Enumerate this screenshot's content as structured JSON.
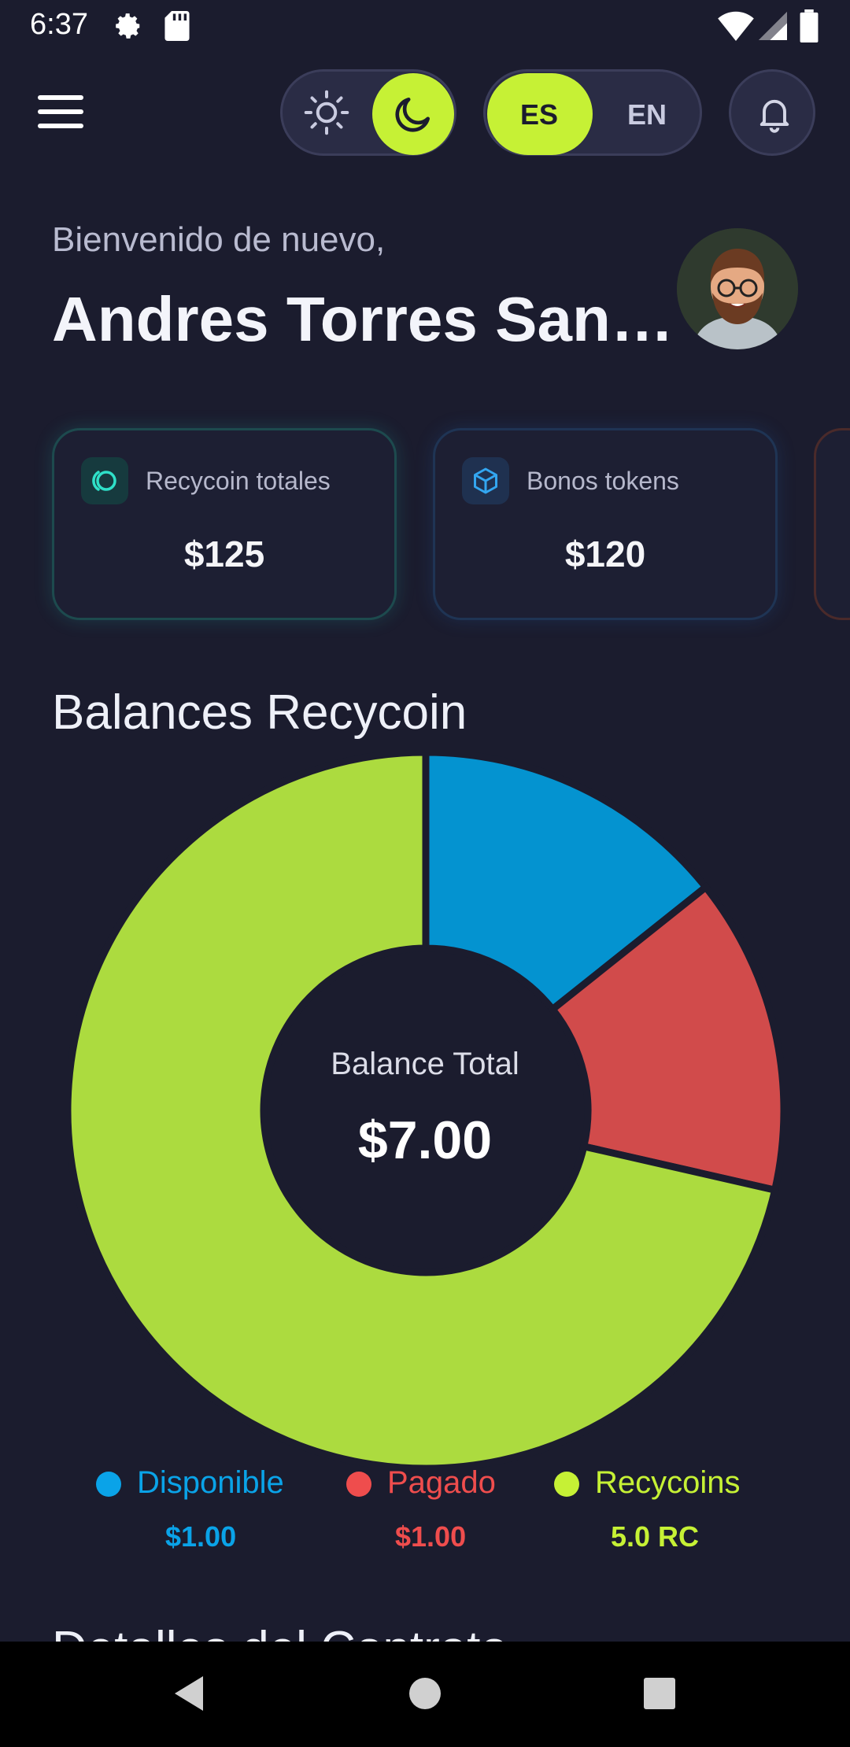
{
  "status_bar": {
    "time": "6:37"
  },
  "header": {
    "lang_es": "ES",
    "lang_en": "EN"
  },
  "welcome": {
    "greeting": "Bienvenido de nuevo,",
    "name": "Andres Torres San…"
  },
  "cards": [
    {
      "label": "Recycoin totales",
      "value": "$125"
    },
    {
      "label": "Bonos tokens",
      "value": "$120"
    }
  ],
  "chart_section": {
    "title": "Balances Recycoin"
  },
  "chart_data": {
    "type": "pie",
    "categories": [
      "Disponible",
      "Pagado",
      "Recycoins"
    ],
    "values": [
      1.0,
      1.0,
      5.0
    ],
    "colors": [
      "#0493d0",
      "#d14b4b",
      "#acdb3f"
    ],
    "center_label": "Balance Total",
    "center_value": "$7.00",
    "legend": [
      {
        "name": "Disponible",
        "amount": "$1.00",
        "color": "#0aa3e8"
      },
      {
        "name": "Pagado",
        "amount": "$1.00",
        "color": "#ef4d4d"
      },
      {
        "name": "Recycoins",
        "amount": "5.0 RC",
        "color": "#c6f135"
      }
    ]
  },
  "next_section": {
    "title": "Detalles del Contrato"
  }
}
